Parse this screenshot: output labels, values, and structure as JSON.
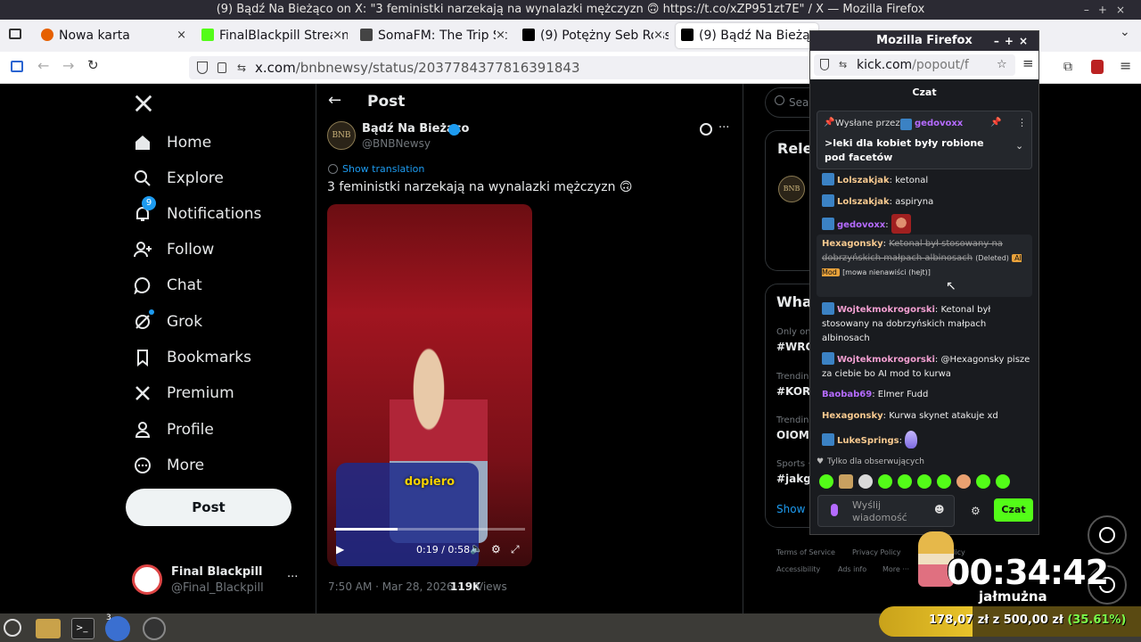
{
  "window_title": "(9) Bądź Na Bieżąco on X: \"3 feministki narzekają na wynalazki mężczyzn 🙃 https://t.co/xZP951zt7E\" / X — Mozilla Firefox",
  "tabs": [
    {
      "label": "Nowa karta",
      "color": "#e66000"
    },
    {
      "label": "FinalBlackpill Stream",
      "color": "#53fc18"
    },
    {
      "label": "SomaFM: The Trip Sc",
      "color": "#444"
    },
    {
      "label": "(9) Potężny Seb Ross",
      "color": "#000"
    },
    {
      "label": "(9) Bądź Na Bieżąco",
      "color": "#000"
    }
  ],
  "url": {
    "host": "x.com",
    "path": "/bnbnewsy/status/2037784377816391843"
  },
  "nav": {
    "home": "Home",
    "explore": "Explore",
    "notifications": "Notifications",
    "notif_count": "9",
    "follow": "Follow",
    "chat": "Chat",
    "grok": "Grok",
    "bookmarks": "Bookmarks",
    "premium": "Premium",
    "profile": "Profile",
    "more": "More",
    "post_button": "Post"
  },
  "account": {
    "name": "Final Blackpill",
    "handle": "@Final_Blackpill",
    "more": "···"
  },
  "post": {
    "header": "Post",
    "author_name": "Bądź Na Bieżąco",
    "author_handle": "@BNBNewsy",
    "avatar_text": "BNB",
    "translate": "Show translation",
    "text": "3 feministki narzekają na wynalazki mężczyzn 🙃",
    "video_caption": "dopiero",
    "video_time": "0:19 / 0:58",
    "video_progress": 0.33,
    "timestamp": "7:50 AM · Mar 28, 2026 ·",
    "views_count": "119K",
    "views_label": "Views"
  },
  "right": {
    "search": "Searc",
    "relevant": "Rele",
    "what": "Wha",
    "t1_meta": "Only on",
    "t1_tag": "#WRO",
    "t2_meta": "Trendin",
    "t2_tag": "#KOR",
    "t3_meta": "Trendin",
    "t3_tag": "OIOM",
    "t4_meta": "Sports ·",
    "t4_tag": "#jakg",
    "show_more": "Show n",
    "footer1": "Terms of Service",
    "footer2": "Privacy Policy",
    "footer3": "Cookie Policy",
    "footer4": "Accessibility",
    "footer5": "Ads info",
    "footer6": "More ···"
  },
  "kick": {
    "window_title": "Mozilla Firefox",
    "url_host": "kick.com",
    "url_path": "/popout/f",
    "header": "Czat",
    "pinned_by_label": "Wysłane przez",
    "pinned_by_user": "gedovoxx",
    "pinned_text": ">leki dla kobiet były robione pod facetów",
    "messages": [
      {
        "user": "Lolszakjak",
        "text": "ketonal"
      },
      {
        "user": "Lolszakjak",
        "text": "aspiryna"
      },
      {
        "user": "gedovoxx",
        "text": ""
      },
      {
        "user": "Hexagonsky",
        "text": "Ketonal był stosowany na dobrzyńskich małpach albinosach",
        "deleted": "(Deleted)",
        "badge": "AI Mod",
        "reason": "[mowa nienawiści (hejt)]"
      },
      {
        "user": "Wojtekmokrogorski",
        "text": "Ketonal był stosowany na dobrzyńskich małpach albinosach"
      },
      {
        "user": "Wojtekmokrogorski",
        "text": "@Hexagonsky pisze za ciebie bo AI mod to kurwa"
      },
      {
        "user": "Baobab69",
        "text": "Elmer Fudd"
      },
      {
        "user": "Hexagonsky",
        "text": "Kurwa skynet atakuje xd"
      },
      {
        "user": "LukeSprings",
        "text": ""
      }
    ],
    "followers_only": "Tylko dla obserwujących",
    "input_placeholder": "Wyślij wiadomość",
    "send_button": "Czat"
  },
  "overlay": {
    "timer": "00:34:42",
    "label": "jałmużna",
    "goal_current": "178,07 zł",
    "goal_sep": "z",
    "goal_total": "500,00 zł",
    "goal_percent": "(35.61%)",
    "goal_fraction": 0.3561
  },
  "taskbar": {
    "firefox_count": "3"
  }
}
